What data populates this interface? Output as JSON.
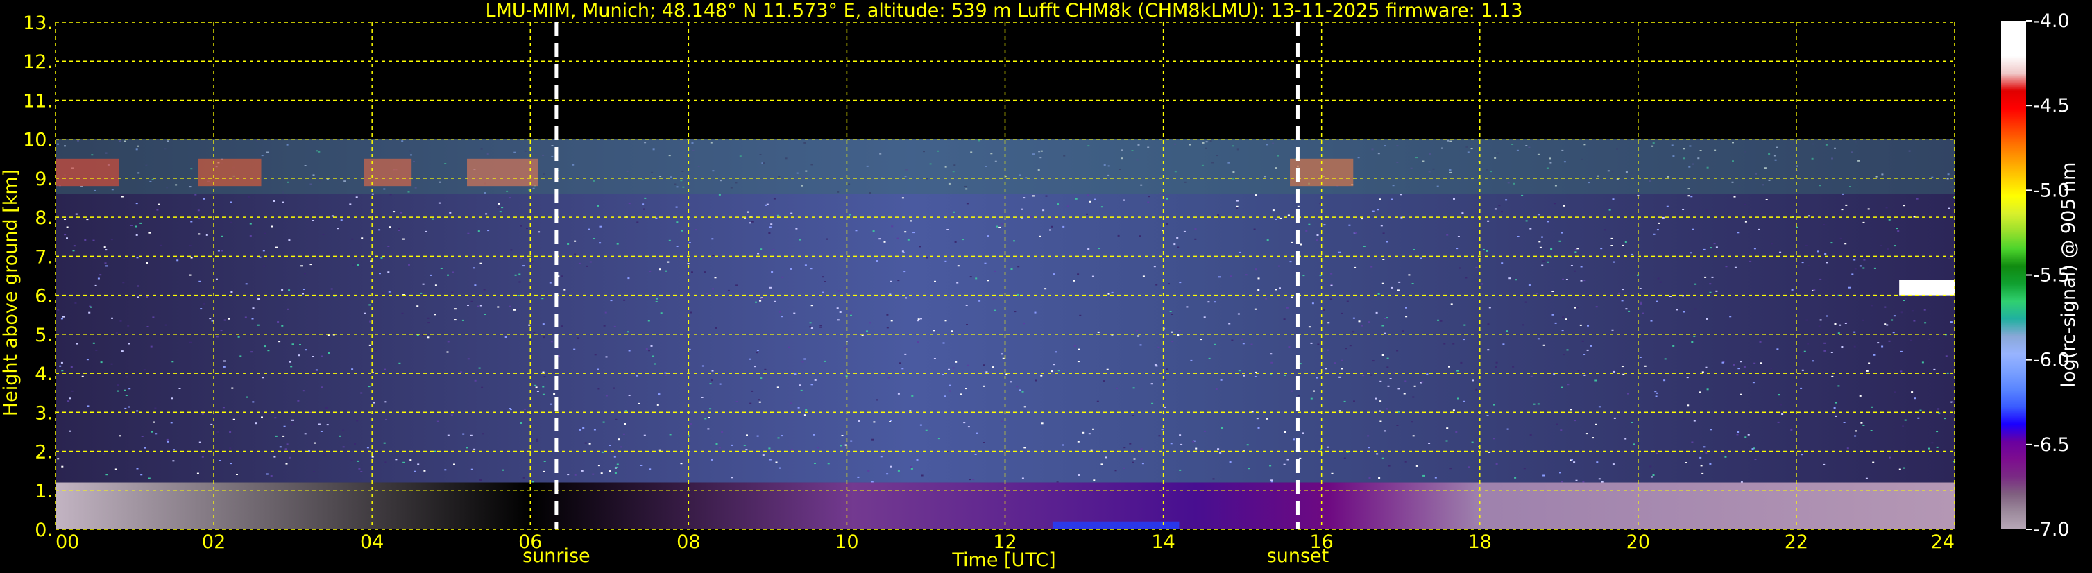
{
  "chart_data": {
    "type": "heatmap",
    "title": "LMU-MIM, Munich; 48.148° N 11.573° E, altitude: 539 m    Lufft CHM8k (CHM8kLMU): 13-11-2025    firmware: 1.13",
    "xlabel": "Time [UTC]",
    "ylabel": "Height above ground [km]",
    "xlim": [
      0,
      24
    ],
    "ylim": [
      0,
      13
    ],
    "x_ticks": [
      0,
      2,
      4,
      6,
      8,
      10,
      12,
      14,
      16,
      18,
      20,
      22,
      24
    ],
    "x_tick_labels": [
      "00",
      "02",
      "04",
      "06",
      "08",
      "10",
      "12",
      "14",
      "16",
      "18",
      "20",
      "22",
      "24"
    ],
    "y_ticks": [
      0,
      1,
      2,
      3,
      4,
      5,
      6,
      7,
      8,
      9,
      10,
      11,
      12,
      13
    ],
    "y_tick_labels": [
      "0.",
      "1.",
      "2.",
      "3.",
      "4.",
      "5.",
      "6.",
      "7.",
      "8.",
      "9.",
      "10.",
      "11.",
      "12.",
      "13."
    ],
    "grid": true,
    "grid_color": "#ffff00",
    "data_top_km": 10,
    "markers": [
      {
        "label": "sunrise",
        "x": 6.33
      },
      {
        "label": "sunset",
        "x": 15.7
      }
    ],
    "colorbar": {
      "label": "log(rc-signal) @ 905 nm",
      "range": [
        -7.0,
        -4.0
      ],
      "tick_values": [
        -4.0,
        -4.5,
        -5.0,
        -5.5,
        -6.0,
        -6.5,
        -7.0
      ],
      "tick_labels": [
        "-4.0",
        "-4.5",
        "-5.0",
        "-5.5",
        "-6.0",
        "-6.5",
        "-7.0"
      ],
      "colors": [
        "#b8a8b8",
        "#9c8a9c",
        "#806080",
        "#7a2a84",
        "#7d0d8f",
        "#6a00a0",
        "#1a00ff",
        "#3a5cff",
        "#5a86ff",
        "#7aa0ff",
        "#98b4ff",
        "#8aa8d8",
        "#20b0a0",
        "#30d070",
        "#10a030",
        "#108a10",
        "#4cd42c",
        "#9ae02c",
        "#d8f02c",
        "#ffff00",
        "#ffd000",
        "#ffa000",
        "#ff7000",
        "#ff3800",
        "#ff0000",
        "#e00000",
        "#f0c8c8",
        "#ffffff",
        "#ffffff",
        "#ffffff"
      ]
    },
    "features": [
      {
        "kind": "high cirrus band",
        "x_range": [
          0,
          24
        ],
        "y_range": [
          8,
          10
        ]
      },
      {
        "kind": "boundary layer aerosol",
        "x_range": [
          0,
          24
        ],
        "y_range": [
          0,
          1.2
        ]
      },
      {
        "kind": "strong return patch",
        "x_range": [
          23.2,
          24
        ],
        "y_range": [
          6.0,
          6.4
        ]
      }
    ]
  }
}
